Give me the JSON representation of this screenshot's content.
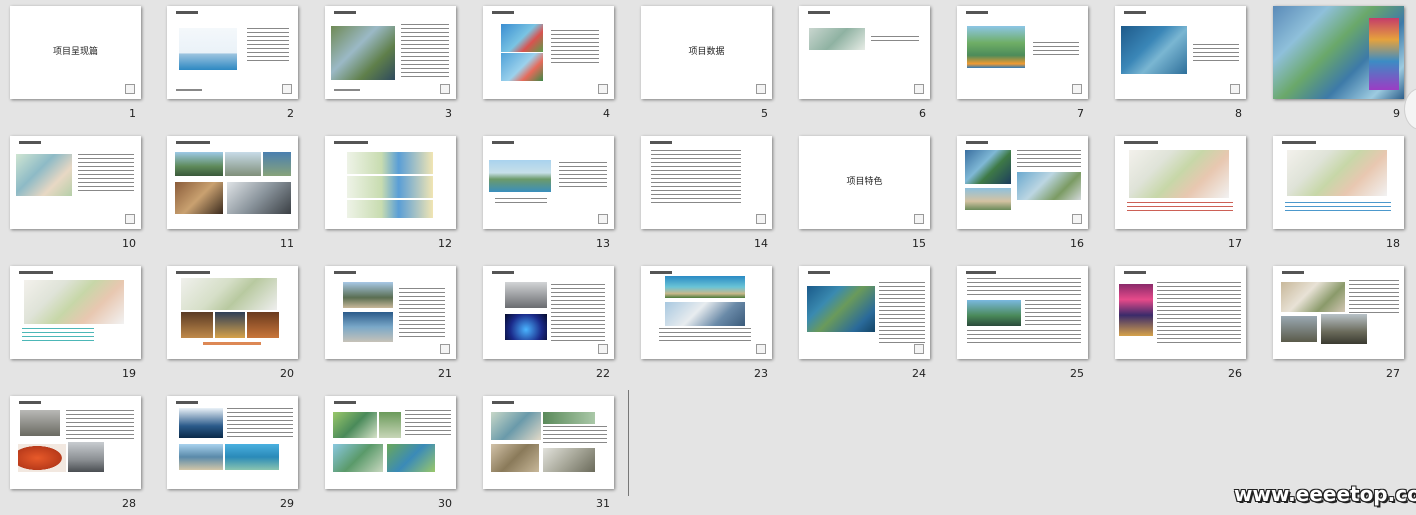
{
  "slides": [
    {
      "num": "1",
      "title": "项目呈现篇"
    },
    {
      "num": "2",
      "title": ""
    },
    {
      "num": "3",
      "title": ""
    },
    {
      "num": "4",
      "title": ""
    },
    {
      "num": "5",
      "title": "项目数据"
    },
    {
      "num": "6",
      "title": ""
    },
    {
      "num": "7",
      "title": ""
    },
    {
      "num": "8",
      "title": ""
    },
    {
      "num": "9",
      "title": ""
    },
    {
      "num": "10",
      "title": ""
    },
    {
      "num": "11",
      "title": ""
    },
    {
      "num": "12",
      "title": ""
    },
    {
      "num": "13",
      "title": ""
    },
    {
      "num": "14",
      "title": ""
    },
    {
      "num": "15",
      "title": "项目特色"
    },
    {
      "num": "16",
      "title": ""
    },
    {
      "num": "17",
      "title": ""
    },
    {
      "num": "18",
      "title": ""
    },
    {
      "num": "19",
      "title": ""
    },
    {
      "num": "20",
      "title": ""
    },
    {
      "num": "21",
      "title": ""
    },
    {
      "num": "22",
      "title": ""
    },
    {
      "num": "23",
      "title": ""
    },
    {
      "num": "24",
      "title": ""
    },
    {
      "num": "25",
      "title": ""
    },
    {
      "num": "26",
      "title": ""
    },
    {
      "num": "27",
      "title": ""
    },
    {
      "num": "28",
      "title": ""
    },
    {
      "num": "29",
      "title": ""
    },
    {
      "num": "30",
      "title": ""
    },
    {
      "num": "31",
      "title": ""
    }
  ],
  "watermark": "www.eeeetop.com",
  "colors": {
    "background": "#e4e4e4",
    "slide": "#ffffff"
  }
}
